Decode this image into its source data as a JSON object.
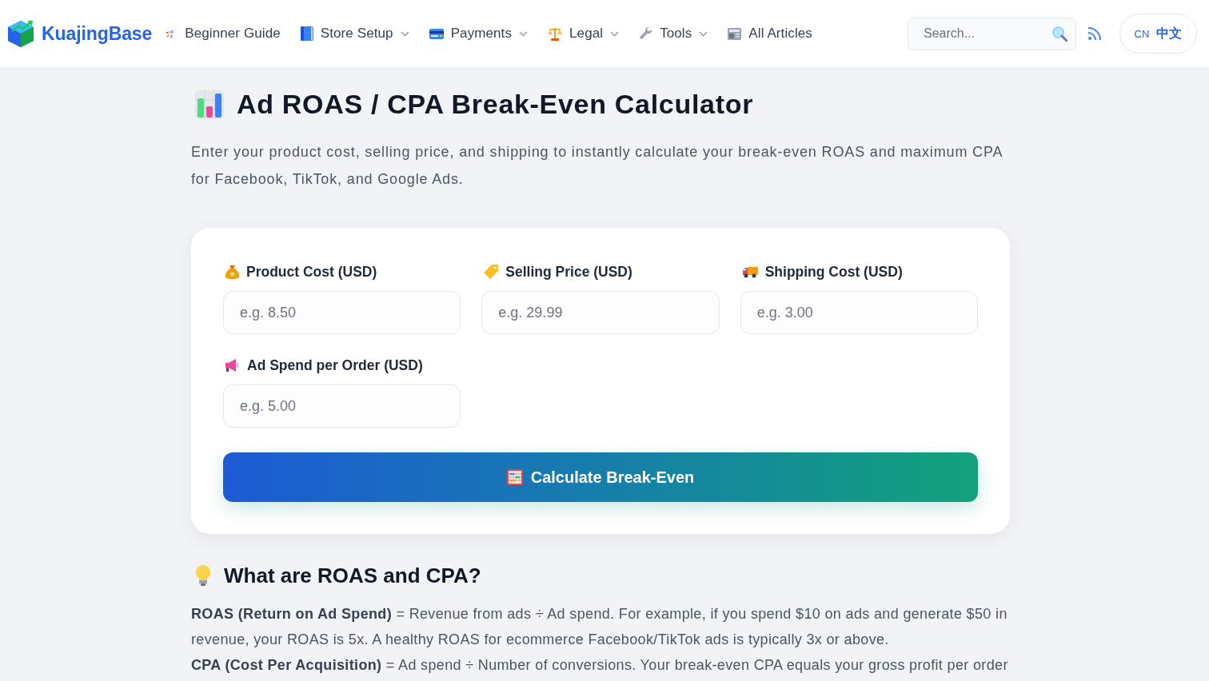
{
  "header": {
    "brand": "KuajingBase",
    "nav": [
      {
        "label": "Beginner Guide",
        "dropdown": false
      },
      {
        "label": "Store Setup",
        "dropdown": true
      },
      {
        "label": "Payments",
        "dropdown": true
      },
      {
        "label": "Legal",
        "dropdown": true
      },
      {
        "label": "Tools",
        "dropdown": true
      },
      {
        "label": "All Articles",
        "dropdown": false
      }
    ],
    "search": {
      "placeholder": "Search..."
    },
    "language": {
      "code": "CN",
      "label": "中文"
    }
  },
  "page": {
    "title": "Ad ROAS / CPA Break-Even Calculator",
    "description": "Enter your product cost, selling price, and shipping to instantly calculate your break-even ROAS and maximum CPA for Facebook, TikTok, and Google Ads."
  },
  "calculator": {
    "fields": [
      {
        "label": "Product Cost (USD)",
        "placeholder": "e.g. 8.50"
      },
      {
        "label": "Selling Price (USD)",
        "placeholder": "e.g. 29.99"
      },
      {
        "label": "Shipping Cost (USD)",
        "placeholder": "e.g. 3.00"
      },
      {
        "label": "Ad Spend per Order (USD)",
        "placeholder": "e.g. 5.00"
      }
    ],
    "button": "Calculate Break-Even"
  },
  "explainer": {
    "heading": "What are ROAS and CPA?",
    "paragraphs": [
      "**ROAS (Return on Ad Spend)** = Revenue from ads ÷ Ad spend. For example, if you spend $10 on ads and generate $50 in revenue, your ROAS is 5x. A healthy ROAS for ecommerce Facebook/TikTok ads is typically 3x or above.",
      "**CPA (Cost Per Acquisition)** = Ad spend ÷ Number of conversions. Your break-even CPA equals your gross profit per order"
    ]
  }
}
